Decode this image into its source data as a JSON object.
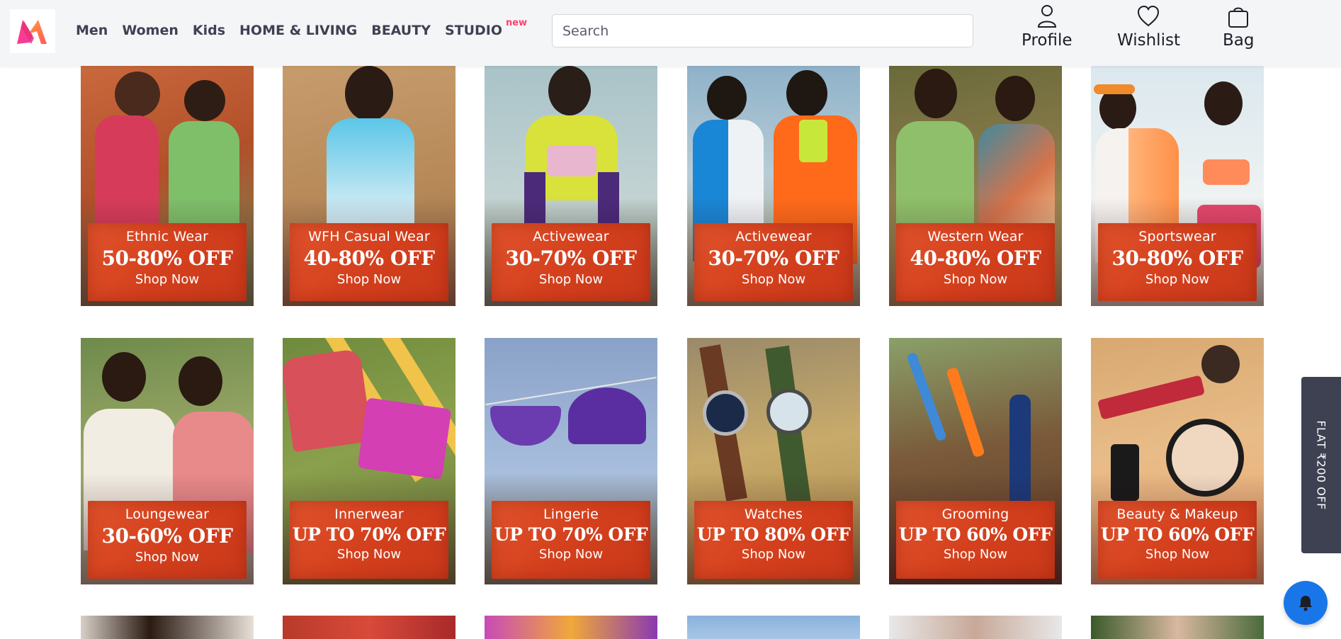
{
  "header": {
    "logo_alt": "Myntra",
    "nav": [
      {
        "label": "Men"
      },
      {
        "label": "Women"
      },
      {
        "label": "Kids"
      },
      {
        "label": "HOME & LIVING"
      },
      {
        "label": "BEAUTY"
      },
      {
        "label": "STUDIO",
        "badge": "new"
      }
    ],
    "search": {
      "placeholder": "Search",
      "value": ""
    },
    "actions": {
      "profile": "Profile",
      "wishlist": "Wishlist",
      "bag": "Bag"
    }
  },
  "banners": [
    {
      "category": "Ethnic Wear",
      "offer": "50-80% OFF",
      "cta": "Shop Now"
    },
    {
      "category": "WFH Casual Wear",
      "offer": "40-80% OFF",
      "cta": "Shop Now"
    },
    {
      "category": "Activewear",
      "offer": "30-70% OFF",
      "cta": "Shop Now"
    },
    {
      "category": "Activewear",
      "offer": "30-70% OFF",
      "cta": "Shop Now"
    },
    {
      "category": "Western Wear",
      "offer": "40-80% OFF",
      "cta": "Shop Now"
    },
    {
      "category": "Sportswear",
      "offer": "30-80% OFF",
      "cta": "Shop Now"
    },
    {
      "category": "Loungewear",
      "offer": "30-60% OFF",
      "cta": "Shop Now"
    },
    {
      "category": "Innerwear",
      "offer": "UP TO 70% OFF",
      "cta": "Shop Now"
    },
    {
      "category": "Lingerie",
      "offer": "UP TO 70% OFF",
      "cta": "Shop Now"
    },
    {
      "category": "Watches",
      "offer": "UP TO 80% OFF",
      "cta": "Shop Now"
    },
    {
      "category": "Grooming",
      "offer": "UP TO 60% OFF",
      "cta": "Shop Now"
    },
    {
      "category": "Beauty & Makeup",
      "offer": "UP TO 60% OFF",
      "cta": "Shop Now"
    }
  ],
  "side_tab": {
    "label": "FLAT ₹200 OFF"
  },
  "colors": {
    "brand_pink": "#ff3f6c",
    "promo_orange": "#d4401d",
    "notify_blue": "#1976e8",
    "side_tab": "#3e4152"
  },
  "icons": {
    "profile": "person-icon",
    "wishlist": "heart-icon",
    "bag": "shopping-bag-icon",
    "notifications": "bell-icon"
  }
}
